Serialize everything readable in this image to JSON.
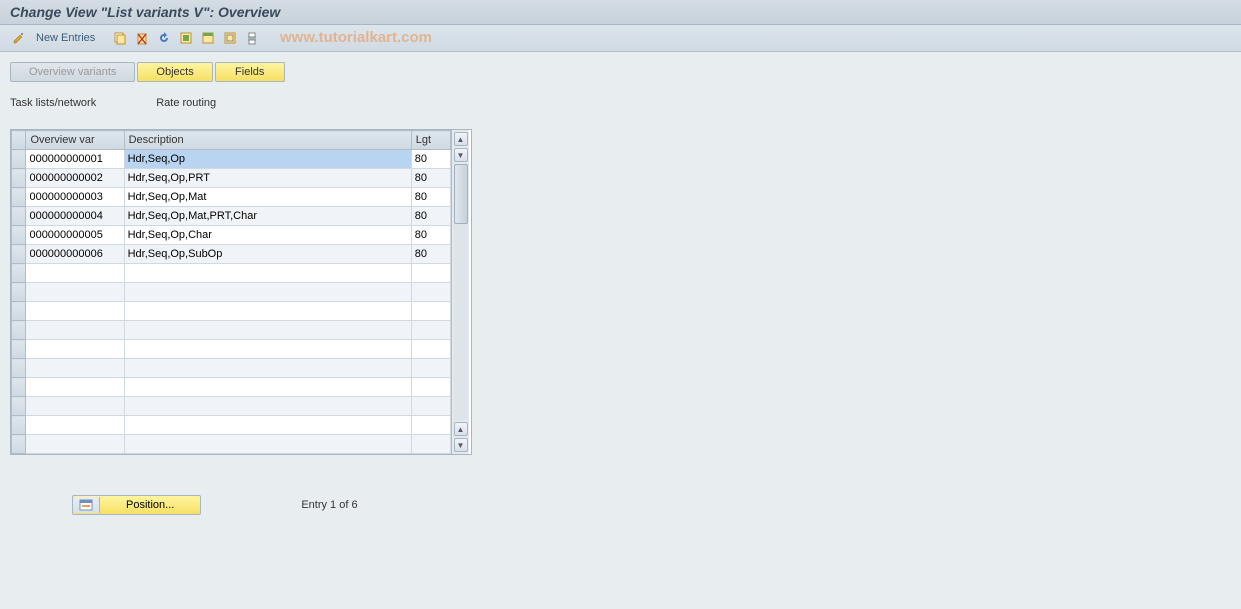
{
  "title": "Change View \"List variants                    V\": Overview",
  "toolbar": {
    "new_entries": "New Entries"
  },
  "watermark": "www.tutorialkart.com",
  "tabs": {
    "overview_variants": "Overview variants",
    "objects": "Objects",
    "fields": "Fields"
  },
  "info": {
    "label1": "Task lists/network",
    "label2": "Rate routing"
  },
  "table": {
    "headers": {
      "overview_var": "Overview var",
      "description": "Description",
      "lgt": "Lgt"
    },
    "rows": [
      {
        "var": "000000000001",
        "desc": "Hdr,Seq,Op",
        "lgt": "80",
        "selected": true
      },
      {
        "var": "000000000002",
        "desc": "Hdr,Seq,Op,PRT",
        "lgt": "80",
        "selected": false
      },
      {
        "var": "000000000003",
        "desc": "Hdr,Seq,Op,Mat",
        "lgt": "80",
        "selected": false
      },
      {
        "var": "000000000004",
        "desc": "Hdr,Seq,Op,Mat,PRT,Char",
        "lgt": "80",
        "selected": false
      },
      {
        "var": "000000000005",
        "desc": "Hdr,Seq,Op,Char",
        "lgt": "80",
        "selected": false
      },
      {
        "var": "000000000006",
        "desc": "Hdr,Seq,Op,SubOp",
        "lgt": "80",
        "selected": false
      }
    ],
    "empty_rows": 10
  },
  "footer": {
    "position_label": "Position...",
    "entry_text": "Entry 1 of 6"
  }
}
